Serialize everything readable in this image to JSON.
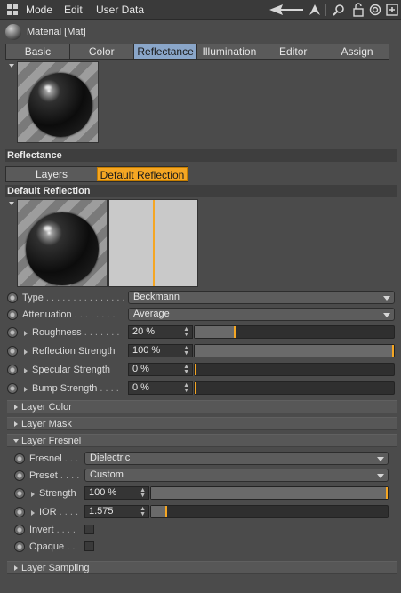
{
  "menu": {
    "items": [
      "Mode",
      "Edit",
      "User Data"
    ]
  },
  "header": {
    "title": "Material [Mat]"
  },
  "tabs": [
    "Basic",
    "Color",
    "Reflectance",
    "Illumination",
    "Editor",
    "Assign"
  ],
  "active_tab": "Reflectance",
  "reflectance": {
    "section_label": "Reflectance",
    "layers_label": "Layers",
    "default_reflection_label": "Default Reflection",
    "section2_label": "Default Reflection"
  },
  "params": {
    "type": {
      "label": "Type",
      "dots": " . . . . . . . . . . . . . . .",
      "value": "Beckmann"
    },
    "attenuation": {
      "label": "Attenuation",
      "dots": " . . . . . . . .",
      "value": "Average"
    },
    "roughness": {
      "label": "Roughness",
      "dots": " . . . . . . .",
      "value": "20 %",
      "fraction": 0.2
    },
    "reflection_strength": {
      "label": "Reflection Strength",
      "value": "100 %",
      "fraction": 1.0
    },
    "specular_strength": {
      "label": "Specular Strength",
      "value": "0 %",
      "fraction": 0.0
    },
    "bump_strength": {
      "label": "Bump Strength",
      "dots": " . . . .",
      "value": "0 %",
      "fraction": 0.0
    }
  },
  "expanders": {
    "layer_color": "Layer Color",
    "layer_mask": "Layer Mask",
    "layer_fresnel": "Layer Fresnel",
    "layer_sampling": "Layer Sampling"
  },
  "fresnel": {
    "fresnel": {
      "label": "Fresnel",
      "dots": " . . .",
      "value": "Dielectric"
    },
    "preset": {
      "label": "Preset",
      "dots": " . . . .",
      "value": "Custom"
    },
    "strength": {
      "label": "Strength",
      "value": "100 %",
      "fraction": 1.0
    },
    "ior": {
      "label": "IOR",
      "dots": " . . . .",
      "value": "1.575",
      "fraction": 0.06
    },
    "invert": {
      "label": "Invert",
      "dots": " . . . .",
      "checked": false
    },
    "opaque": {
      "label": "Opaque",
      "dots": " . .",
      "checked": false
    }
  },
  "icons": [
    "arrow-left-icon",
    "arrow-up-icon",
    "search-icon",
    "lock-icon",
    "target-icon",
    "new-window-icon"
  ],
  "colors": {
    "accent_orange": "#f5a623",
    "active_tab": "#8aa6c9",
    "background": "#4b4b4b"
  }
}
